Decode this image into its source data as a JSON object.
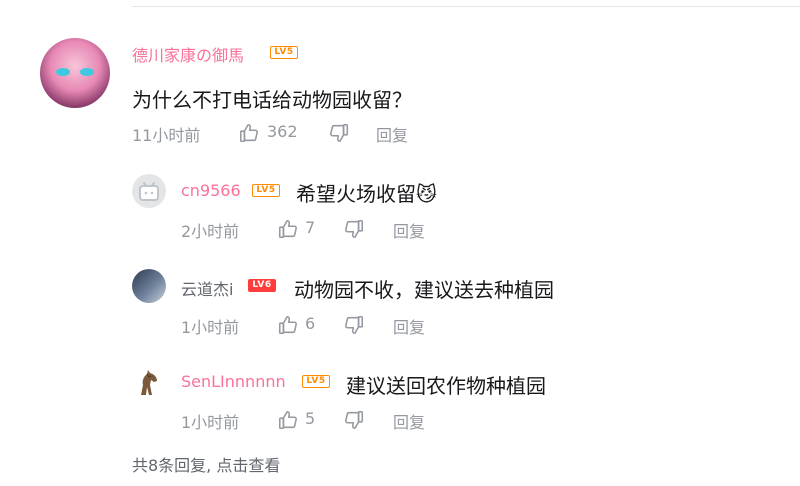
{
  "main_comment": {
    "username": "德川家康の御馬",
    "level": "LV5",
    "content": "为什么不打电话给动物园收留？",
    "time": "11小时前",
    "likes": "362",
    "reply_label": "回复"
  },
  "replies": [
    {
      "username": "cn9566",
      "level": "LV5",
      "content": "希望火场收留",
      "emoji": "😼",
      "time": "2小时前",
      "likes": "7",
      "reply_label": "回复"
    },
    {
      "username": "云道杰i",
      "level": "LV6",
      "content": "动物园不收，建议送去种植园",
      "time": "1小时前",
      "likes": "6",
      "reply_label": "回复"
    },
    {
      "username": "SenLInnnnnn",
      "level": "LV5",
      "content": "建议送回农作物种植园",
      "time": "1小时前",
      "likes": "5",
      "reply_label": "回复"
    }
  ],
  "footer": {
    "more_replies": "共8条回复, 点击查看"
  },
  "colors": {
    "vip_name": "#fb7299",
    "level_orange": "#ff8c00",
    "level_red": "#ff3d3d",
    "meta_grey": "#9499a0"
  },
  "icons": [
    "thumbs-up-icon",
    "thumbs-down-icon",
    "tv-avatar-icon",
    "horse-avatar-icon"
  ]
}
